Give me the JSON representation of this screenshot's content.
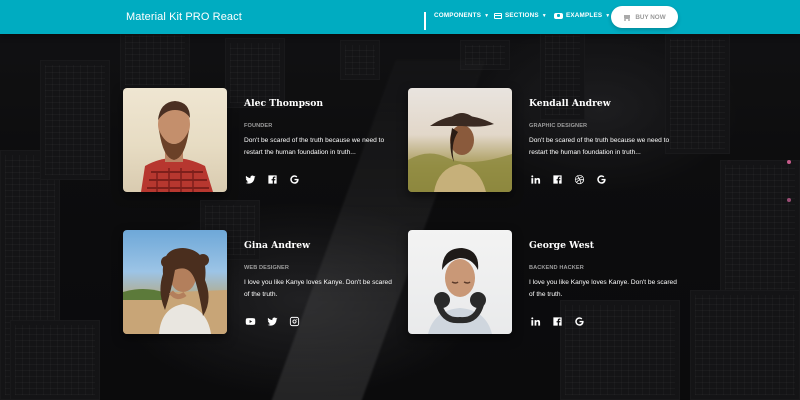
{
  "navbar": {
    "brand": "Material Kit PRO React",
    "items": [
      {
        "label": "COMPONENTS",
        "icon": "apps-icon"
      },
      {
        "label": "SECTIONS",
        "icon": "view-day-icon"
      },
      {
        "label": "EXAMPLES",
        "icon": "view-carousel-icon"
      }
    ],
    "buy_label": "BUY NOW",
    "color": "#00acc1"
  },
  "team": [
    {
      "name": "Alec Thompson",
      "role": "FOUNDER",
      "description": "Don't be scared of the truth because we need to restart the human foundation in truth...",
      "socials": [
        "twitter-icon",
        "facebook-icon",
        "google-icon"
      ]
    },
    {
      "name": "Kendall Andrew",
      "role": "GRAPHIC DESIGNER",
      "description": "Don't be scared of the truth because we need to restart the human foundation in truth...",
      "socials": [
        "linkedin-icon",
        "facebook-icon",
        "dribbble-icon",
        "google-icon"
      ]
    },
    {
      "name": "Gina Andrew",
      "role": "WEB DESIGNER",
      "description": "I love you like Kanye loves Kanye. Don't be scared of the truth.",
      "socials": [
        "youtube-icon",
        "twitter-icon",
        "instagram-icon"
      ]
    },
    {
      "name": "George West",
      "role": "BACKEND HACKER",
      "description": "I love you like Kanye loves Kanye. Don't be scared of the truth.",
      "socials": [
        "linkedin-icon",
        "facebook-icon",
        "google-icon"
      ]
    }
  ]
}
